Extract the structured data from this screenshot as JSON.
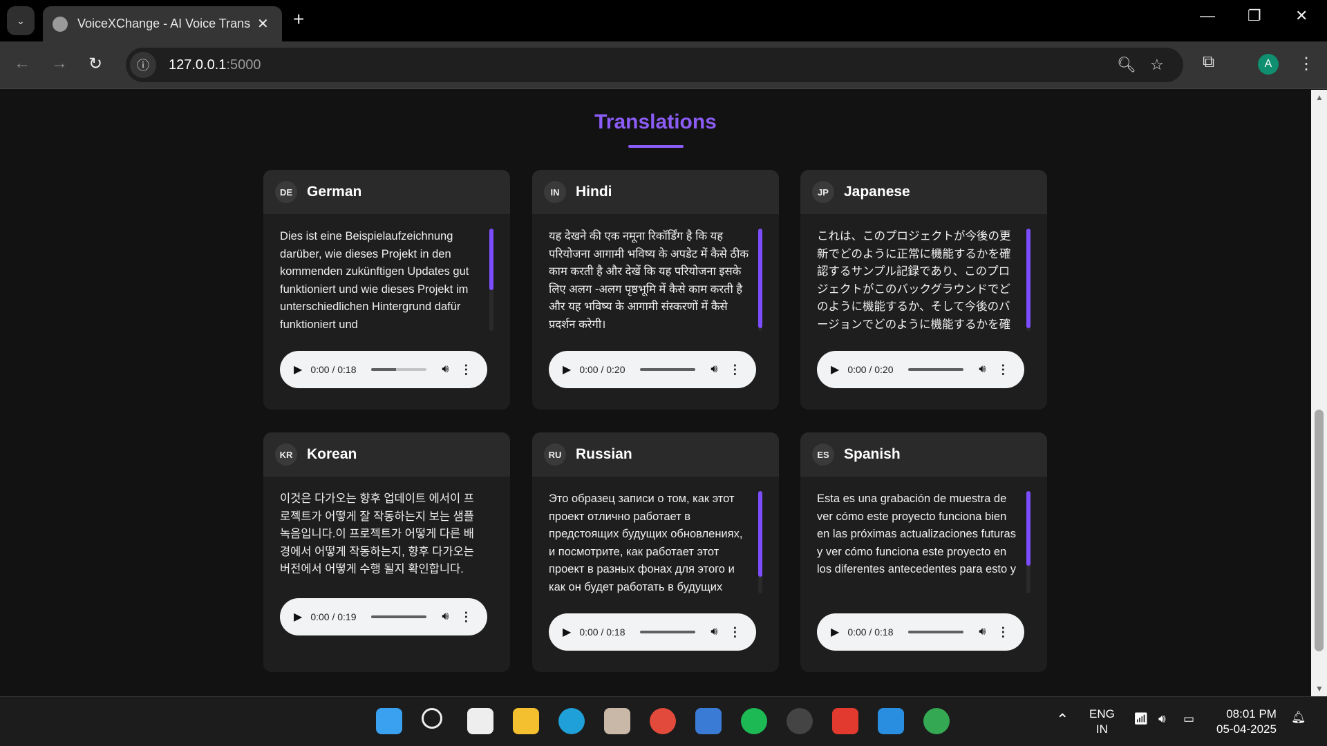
{
  "browser": {
    "tab_title": "VoiceXChange - AI Voice Translator",
    "url_host": "127.0.0.1",
    "url_port": ":5000",
    "avatar_letter": "A"
  },
  "page": {
    "title": "Translations"
  },
  "cards": [
    {
      "code": "DE",
      "language": "German",
      "text": "Dies ist eine Beispielaufzeichnung darüber, wie dieses Projekt in den kommenden zukünftigen Updates gut funktioniert und wie dieses Projekt im unterschiedlichen Hintergrund dafür funktioniert und",
      "time": "0:00 / 0:18",
      "scroll_fraction": 0.6,
      "volume_fraction": 0.45
    },
    {
      "code": "IN",
      "language": "Hindi",
      "text": "यह देखने की एक नमूना रिकॉर्डिंग है कि यह परियोजना आगामी भविष्य के अपडेट में कैसे ठीक काम करती है और देखें कि यह परियोजना इसके लिए अलग -अलग पृष्ठभूमि में कैसे काम करती है और यह भविष्य के आगामी संस्करणों में कैसे प्रदर्शन करेगी।",
      "time": "0:00 / 0:20",
      "scroll_fraction": 0.97,
      "volume_fraction": 1
    },
    {
      "code": "JP",
      "language": "Japanese",
      "text": "これは、このプロジェクトが今後の更新でどのように正常に機能するかを確認するサンプル記録であり、このプロジェクトがこのバックグラウンドでどのように機能するか、そして今後のバージョンでどのように機能するかを確認します。",
      "time": "0:00 / 0:20",
      "scroll_fraction": 0.97,
      "volume_fraction": 1
    },
    {
      "code": "KR",
      "language": "Korean",
      "text": "이것은 다가오는 향후 업데이트 에서이 프로젝트가 어떻게 잘 작동하는지 보는 샘플 녹음입니다.이 프로젝트가 어떻게 다른 배경에서 어떻게 작동하는지, 향후 다가오는 버전에서 어떻게 수행 될지 확인합니다.",
      "time": "0:00 / 0:19",
      "scroll_fraction": 0,
      "volume_fraction": 1
    },
    {
      "code": "RU",
      "language": "Russian",
      "text": "Это образец записи о том, как этот проект отлично работает в предстоящих будущих обновлениях, и посмотрите, как работает этот проект в разных фонах для этого и как он будет работать в будущих предстоящих",
      "time": "0:00 / 0:18",
      "scroll_fraction": 0.84,
      "volume_fraction": 1
    },
    {
      "code": "ES",
      "language": "Spanish",
      "text": "Esta es una grabación de muestra de ver cómo este proyecto funciona bien en las próximas actualizaciones futuras y ver cómo funciona este proyecto en los diferentes antecedentes para esto y",
      "time": "0:00 / 0:18",
      "scroll_fraction": 0.73,
      "volume_fraction": 1
    }
  ],
  "taskbar": {
    "lang1": "ENG",
    "lang2": "IN",
    "time": "08:01 PM",
    "date": "05-04-2025"
  },
  "colors": {
    "accent": "#8b5cf6",
    "background": "#121212",
    "card": "#1e1e1e"
  }
}
